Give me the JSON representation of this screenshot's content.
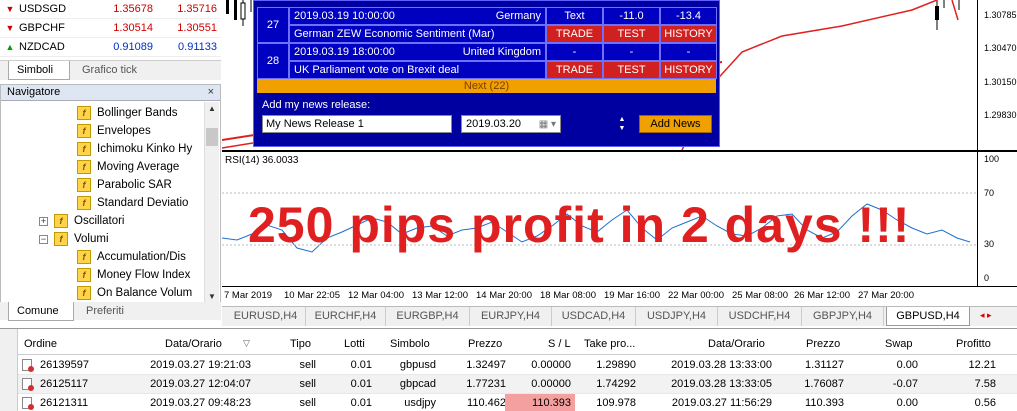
{
  "market_watch": {
    "rows": [
      {
        "symbol": "USDSGD",
        "bid": "1.35678",
        "ask": "1.35716",
        "dir": "down"
      },
      {
        "symbol": "GBPCHF",
        "bid": "1.30514",
        "ask": "1.30551",
        "dir": "up"
      },
      {
        "symbol": "NZDCAD",
        "bid": "0.91089",
        "ask": "0.91133",
        "dir": "up"
      }
    ],
    "tabs": [
      "Simboli",
      "Grafico tick"
    ]
  },
  "navigator": {
    "title": "Navigatore",
    "close": "×",
    "items": [
      {
        "label": "Bollinger Bands",
        "type": "fx"
      },
      {
        "label": "Envelopes",
        "type": "fx"
      },
      {
        "label": "Ichimoku Kinko Hy",
        "type": "fx"
      },
      {
        "label": "Moving Average",
        "type": "fx"
      },
      {
        "label": "Parabolic SAR",
        "type": "fx"
      },
      {
        "label": "Standard Deviatio",
        "type": "fx"
      },
      {
        "label": "Oscillatori",
        "type": "folder-plus"
      },
      {
        "label": "Volumi",
        "type": "folder-minus"
      },
      {
        "label": "Accumulation/Dis",
        "type": "fx"
      },
      {
        "label": "Money Flow Index",
        "type": "fx"
      },
      {
        "label": "On Balance Volum",
        "type": "fx"
      }
    ],
    "tabs": [
      "Comune",
      "Preferiti"
    ]
  },
  "chart": {
    "price_ticks": [
      "1.30785",
      "1.30470",
      "1.30150",
      "1.29830"
    ],
    "rsi_label": "RSI(14) 36.0033",
    "rsi_ticks": [
      "100",
      "70",
      "30",
      "0"
    ],
    "time_ticks": [
      "7 Mar 2019",
      "10 Mar 22:05",
      "12 Mar 04:00",
      "13 Mar 12:00",
      "14 Mar 20:00",
      "18 Mar 08:00",
      "19 Mar 16:00",
      "22 Mar 00:00",
      "25 Mar 08:00",
      "26 Mar 12:00",
      "27 Mar 20:00"
    ],
    "overlay_text": "250 pips profit in 2 days !!!"
  },
  "news": {
    "rows": [
      {
        "idx": "27",
        "datetime": "2019.03.19 10:00:00",
        "country": "Germany",
        "title": "German ZEW Economic Sentiment (Mar)",
        "v1": "Text",
        "v2": "-11.0",
        "v3": "-13.4",
        "b1": "TRADE",
        "b2": "TEST",
        "b3": "HISTORY"
      },
      {
        "idx": "28",
        "datetime": "2019.03.19 18:00:00",
        "country": "United Kingdom",
        "title": "UK Parliament vote on Brexit deal",
        "v1": "-",
        "v2": "-",
        "v3": "-",
        "b1": "TRADE",
        "b2": "TEST",
        "b3": "HISTORY"
      }
    ],
    "next": "Next (22)",
    "add_label": "Add my news release:",
    "input_value": "My News Release 1",
    "date_value": "2019.03.20",
    "add_button": "Add News"
  },
  "symbol_tabs": [
    "EURUSD,H4",
    "EURCHF,H4",
    "EURGBP,H4",
    "EURJPY,H4",
    "USDCAD,H4",
    "USDJPY,H4",
    "USDCHF,H4",
    "GBPJPY,H4",
    "GBPUSD,H4"
  ],
  "symbol_tabs_active": "GBPUSD,H4",
  "terminal": {
    "headers": [
      "Ordine",
      "Data/Orario",
      "Tipo",
      "Lotti",
      "Simbolo",
      "Prezzo",
      "S / L",
      "Take pro...",
      "Data/Orario",
      "Prezzo",
      "Swap",
      "Profitto"
    ],
    "rows": [
      [
        "26139597",
        "2019.03.27 19:21:03",
        "sell",
        "0.01",
        "gbpusd",
        "1.32497",
        "0.00000",
        "1.29890",
        "2019.03.28 13:33:00",
        "1.31127",
        "0.00",
        "12.21"
      ],
      [
        "26125117",
        "2019.03.27 12:04:07",
        "sell",
        "0.01",
        "gbpcad",
        "1.77231",
        "0.00000",
        "1.74292",
        "2019.03.28 13:33:05",
        "1.76087",
        "-0.07",
        "7.58"
      ],
      [
        "26121311",
        "2019.03.27 09:48:23",
        "sell",
        "0.01",
        "usdjpy",
        "110.462",
        "110.393",
        "109.978",
        "2019.03.27 11:56:29",
        "110.393",
        "0.00",
        "0.56"
      ]
    ]
  },
  "colors": {
    "chart_line": "#e02020",
    "rsi_line": "#1e6fd0",
    "news_bg": "#0000a0",
    "button_red": "#d02020",
    "accent_orange": "#f0a000"
  }
}
